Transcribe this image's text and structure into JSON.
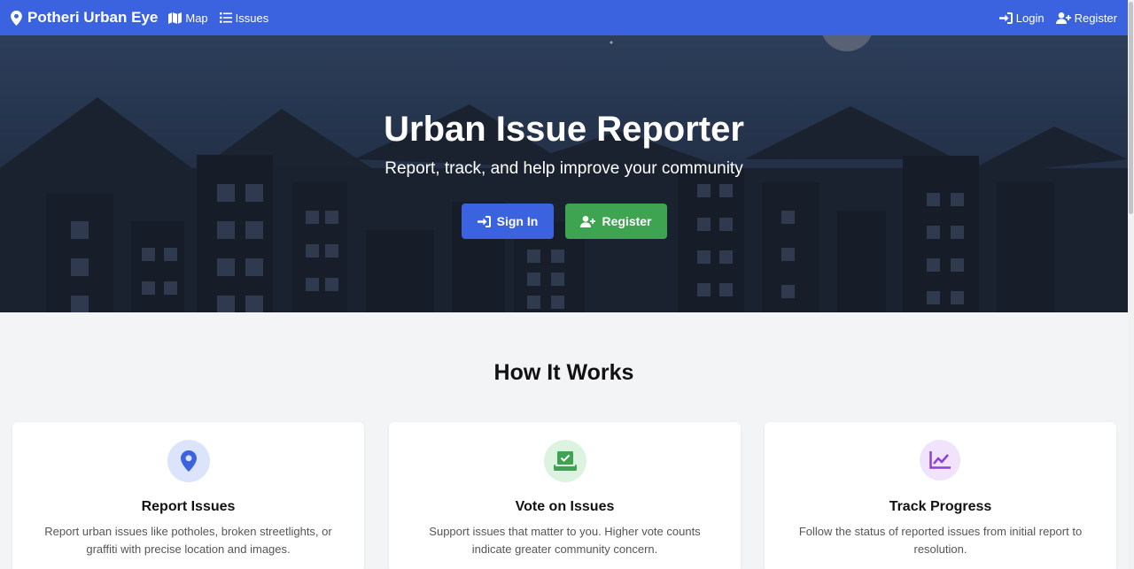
{
  "navbar": {
    "brand": "Potheri Urban Eye",
    "links": [
      {
        "label": "Map",
        "icon": "map-icon"
      },
      {
        "label": "Issues",
        "icon": "list-icon"
      }
    ],
    "right_links": [
      {
        "label": "Login",
        "icon": "login-icon"
      },
      {
        "label": "Register",
        "icon": "user-plus-icon"
      }
    ],
    "color": "#3b63e0"
  },
  "hero": {
    "title": "Urban Issue Reporter",
    "subtitle": "Report, track, and help improve your community",
    "signin_label": "Sign In",
    "register_label": "Register",
    "signin_color": "#3b63e0",
    "register_color": "#3fa452"
  },
  "how_it_works": {
    "title": "How It Works",
    "cards": [
      {
        "title": "Report Issues",
        "text": "Report urban issues like potholes, broken streetlights, or graffiti with precise location and images.",
        "icon": "map-pin-icon",
        "accent": "#3b63e0"
      },
      {
        "title": "Vote on Issues",
        "text": "Support issues that matter to you. Higher vote counts indicate greater community concern.",
        "icon": "vote-icon",
        "accent": "#3fa452"
      },
      {
        "title": "Track Progress",
        "text": "Follow the status of reported issues from initial report to resolution.",
        "icon": "chart-line-icon",
        "accent": "#8b3fd9"
      }
    ]
  }
}
